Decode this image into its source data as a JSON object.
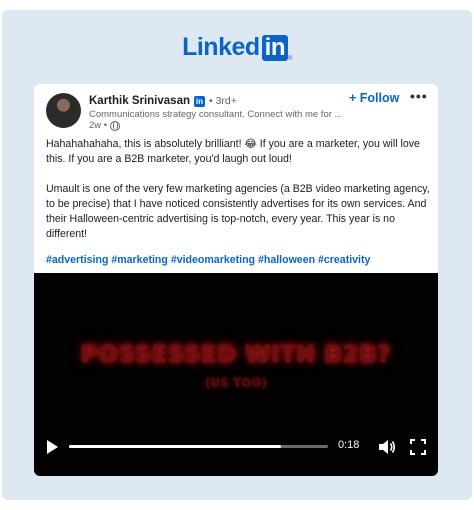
{
  "brand": {
    "logo_text": "Linked",
    "logo_in": "in",
    "logo_reg": "®"
  },
  "post": {
    "author": "Karthik Srinivasan",
    "badge": "in",
    "degree": "• 3rd+",
    "headline": "Communications strategy consultant. Connect with me for ...",
    "time": "2w •",
    "follow_label": "+ Follow",
    "more_label": "•••",
    "paragraphs": [
      "Hahahahahaha, this is absolutely brilliant! 😂 If you are a marketer, you will love this. If you are a B2B marketer, you'd laugh out loud!",
      "Umault is one of the very few marketing agencies (a B2B video marketing agency, to be precise) that I have noticed consistently advertises for its own services. And their Halloween-centric advertising is top-notch, every year. This year is no different!"
    ],
    "hashtags": "#advertising #marketing #videomarketing #halloween #creativity"
  },
  "video": {
    "headline": "POSSESSED WITH B2B?",
    "subline": "(US TOO)",
    "time": "0:18",
    "progress": 0.82
  },
  "icons": {
    "avatar": "author-avatar",
    "globe": "globe-icon",
    "play": "play-icon",
    "volume": "volume-icon",
    "fullscreen": "fullscreen-icon",
    "more": "more-options-icon"
  },
  "colors": {
    "accent": "#0a66c2",
    "background": "#dde8f2",
    "video_text": "#c81a1a"
  }
}
